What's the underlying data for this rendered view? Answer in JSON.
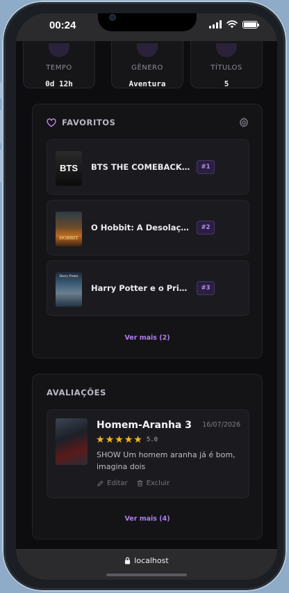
{
  "status_bar": {
    "time": "00:24"
  },
  "stats": [
    {
      "label": "TEMPO",
      "value": "0d 12h"
    },
    {
      "label": "GÊNERO",
      "value": "Aventura"
    },
    {
      "label": "TÍTULOS",
      "value": "5"
    }
  ],
  "favorites": {
    "title": "FAVORITOS",
    "items": [
      {
        "title": "BTS THE COMEBACK L...",
        "rank": "#1",
        "poster_text": "BTS"
      },
      {
        "title": "O Hobbit: A Desolação ...",
        "rank": "#2",
        "poster_text": "HOBBIT"
      },
      {
        "title": "Harry Potter e o Prisio...",
        "rank": "#3",
        "poster_text": "Harry Potter"
      }
    ],
    "see_more": "Ver mais (2)"
  },
  "reviews": {
    "title": "AVALIAÇÕES",
    "items": [
      {
        "title": "Homem-Aranha 3",
        "date": "16/07/2026",
        "rating": 5,
        "score": "5.0",
        "text": "SHOW Um homem aranha já é bom, imagina dois",
        "edit_label": "Editar",
        "delete_label": "Excluir"
      }
    ],
    "see_more": "Ver mais (4)"
  },
  "browser": {
    "url": "localhost"
  },
  "colors": {
    "accent": "#b07ef0",
    "star": "#f5b81c",
    "background": "#0d0d10",
    "card": "#141417"
  }
}
